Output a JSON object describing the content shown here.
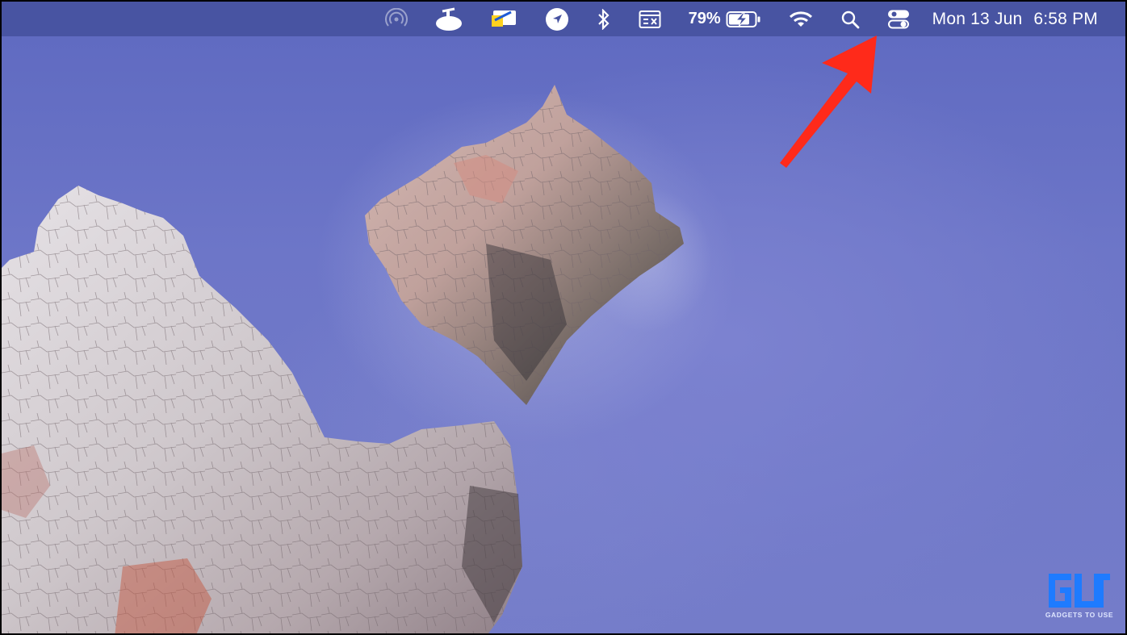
{
  "menubar": {
    "icons": [
      "airdrop-icon",
      "app-status-icon",
      "screen-mirror-app-icon",
      "location-icon",
      "bluetooth-icon",
      "keyboard-viewer-icon",
      "battery-charging-icon",
      "wifi-icon",
      "spotlight-search-icon",
      "control-center-icon"
    ],
    "battery_percent": "79%",
    "date": "Mon 13 Jun",
    "time": "6:58 PM"
  },
  "annotation": {
    "arrow_color": "#ff2a1a",
    "target": "control-center-icon"
  },
  "watermark": {
    "logo_text": "GADGETS TO USE",
    "accent_color": "#1e7bff"
  },
  "colors": {
    "menubar": "#4652a0",
    "wallpaper_sky": "#6d76c8",
    "rock": "#c9c4c8"
  }
}
